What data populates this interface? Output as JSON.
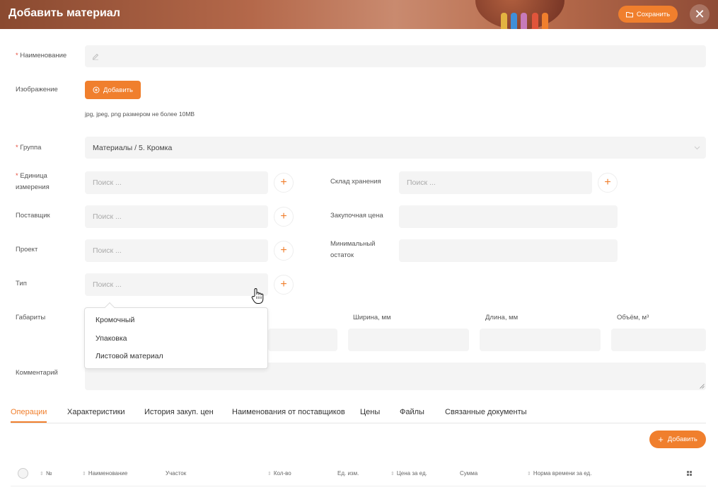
{
  "header": {
    "title": "Добавить материал",
    "save_label": "Сохранить",
    "close_glyph": "✕"
  },
  "form": {
    "name_label": "Наименование",
    "image_label": "Изображение",
    "add_image_label": "Добавить",
    "image_hint": "jpg, jpeg, png размером не более 10MB",
    "group_label": "Группа",
    "group_value": "Материалы / 5. Кромка",
    "unit_label_1": "Единица",
    "unit_label_2": "измерения",
    "unit_placeholder": "Поиск ...",
    "storage_label": "Склад хранения",
    "storage_placeholder": "Поиск ...",
    "supplier_label": "Поставщик",
    "supplier_placeholder": "Поиск ...",
    "purchase_price_label": "Закупочная цена",
    "project_label": "Проект",
    "project_placeholder": "Поиск ...",
    "min_stock_label_1": "Минимальный",
    "min_stock_label_2": "остаток",
    "type_label": "Тип",
    "type_placeholder": "Поиск ...",
    "dimensions_label": "Габариты",
    "width_label": "Ширина, мм",
    "length_label": "Длина, мм",
    "volume_label": "Объём, м³",
    "comment_label": "Комментарий",
    "required_mark": "*",
    "plus_glyph": "+"
  },
  "type_dropdown": {
    "options": [
      "Кромочный",
      "Упаковка",
      "Листовой материал"
    ]
  },
  "tabs": [
    "Операции",
    "Характеристики",
    "История закуп. цен",
    "Наименования от поставщиков",
    "Цены",
    "Файлы",
    "Связанные документы"
  ],
  "table": {
    "add_label": "Добавить",
    "columns": {
      "num": "№",
      "name": "Наименование",
      "section": "Участок",
      "qty": "Кол-во",
      "unit": "Ед. изм.",
      "price": "Цена за ед.",
      "sum": "Сумма",
      "norm": "Норма времени за ед."
    }
  },
  "colors": {
    "accent": "#f07f2d",
    "required": "#e74c3c",
    "field_bg": "#f4f4f4"
  }
}
